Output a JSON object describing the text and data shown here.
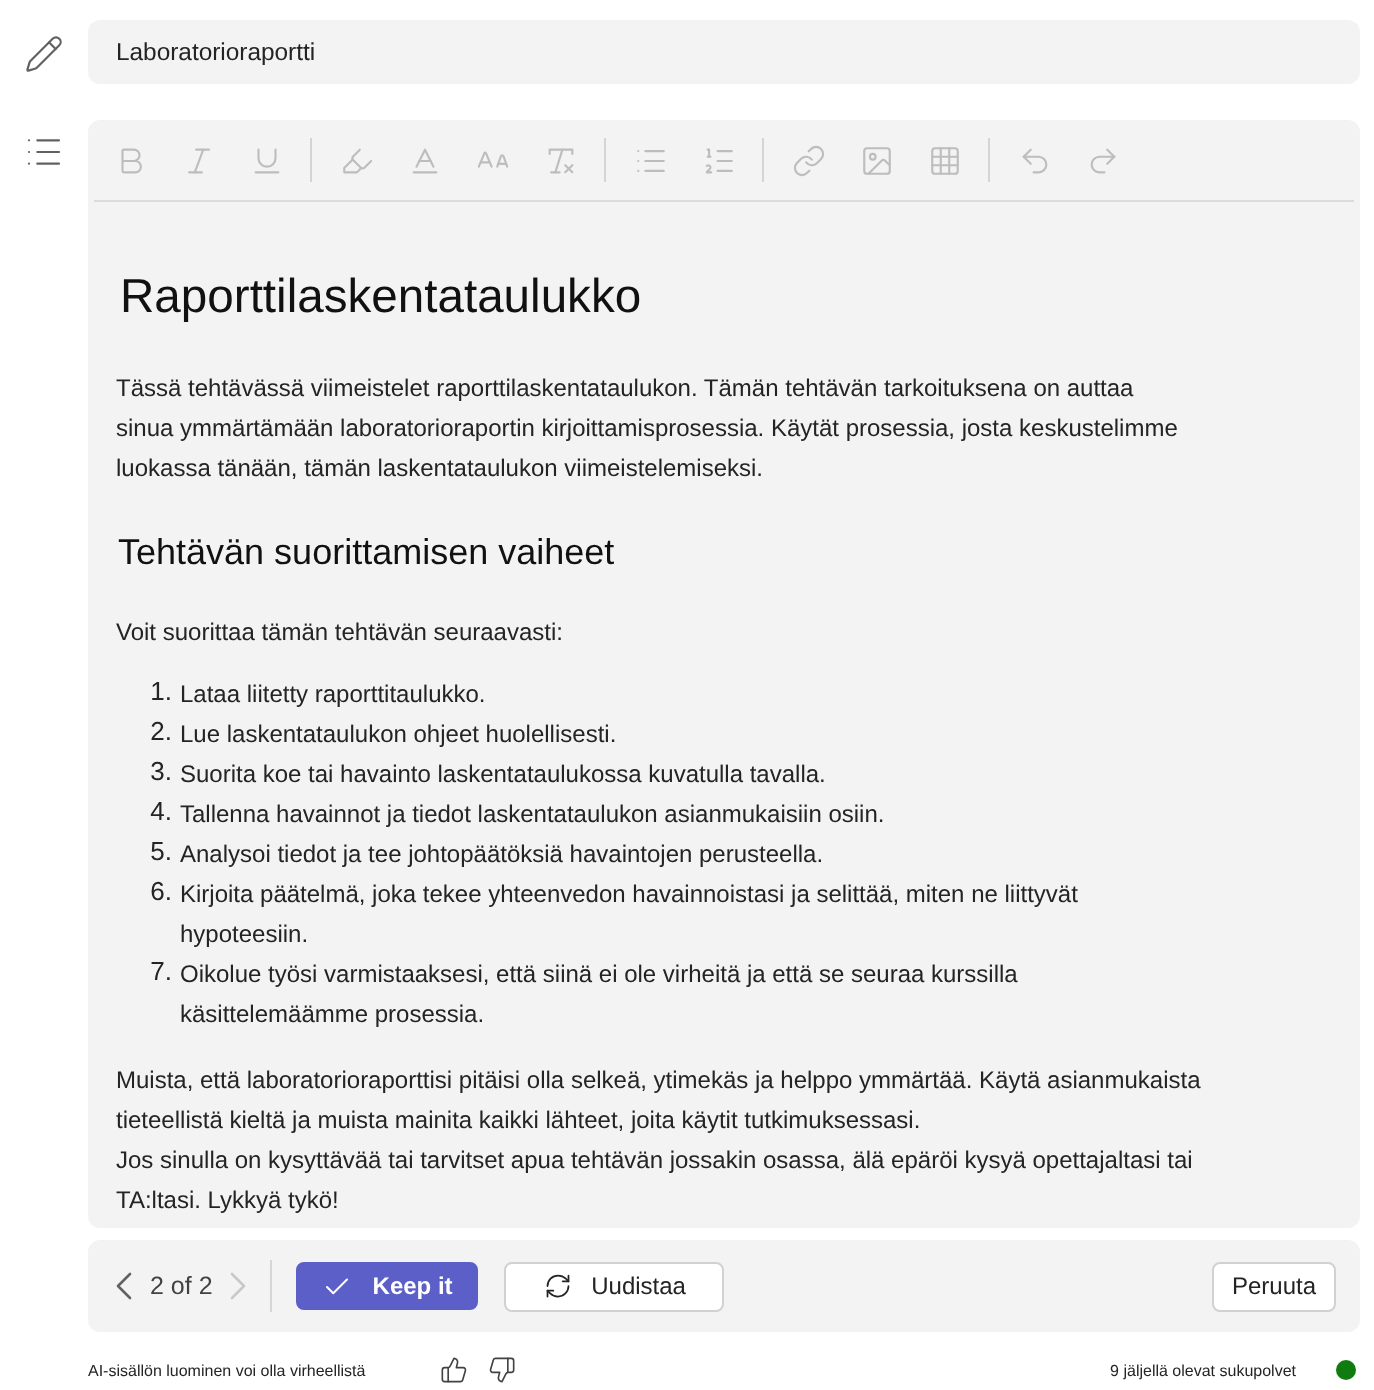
{
  "title_field": {
    "value": "Laboratorioraportti"
  },
  "toolbar": {
    "groups": [
      {
        "tools": [
          {
            "kind": "bold",
            "disabled": true
          },
          {
            "kind": "italic",
            "disabled": true
          },
          {
            "kind": "underline",
            "disabled": true
          }
        ]
      },
      {
        "tools": [
          {
            "kind": "highlight",
            "disabled": true
          },
          {
            "kind": "font_color",
            "disabled": true
          },
          {
            "kind": "font_size",
            "disabled": true
          },
          {
            "kind": "clear_format",
            "disabled": true
          }
        ]
      },
      {
        "tools": [
          {
            "kind": "bulleted_list",
            "disabled": true
          },
          {
            "kind": "numbered_list",
            "disabled": true
          }
        ]
      },
      {
        "tools": [
          {
            "kind": "link",
            "disabled": true
          },
          {
            "kind": "image",
            "disabled": true
          },
          {
            "kind": "table",
            "disabled": true
          }
        ]
      },
      {
        "tools": [
          {
            "kind": "undo",
            "disabled": true
          },
          {
            "kind": "redo",
            "disabled": true
          }
        ]
      }
    ]
  },
  "document": {
    "heading": "Raporttilaskentataulukko",
    "intro": "Tässä tehtävässä viimeistelet raporttilaskentataulukon. Tämän tehtävän tarkoituksena on auttaa sinua ymmärtämään laboratorioraportin kirjoittamisprosessia. Käytät prosessia, josta keskustelimme luokassa tänään, tämän laskentataulukon viimeistelemiseksi.",
    "subheading": "Tehtävän suorittamisen vaiheet",
    "lead": "Voit suorittaa tämän tehtävän seuraavasti:",
    "steps": [
      {
        "number": "1.",
        "text": "Lataa liitetty raporttitaulukko."
      },
      {
        "number": "2.",
        "text": "Lue laskentataulukon ohjeet huolellisesti."
      },
      {
        "number": "3.",
        "text": "Suorita koe tai havainto laskentataulukossa kuvatulla tavalla."
      },
      {
        "number": "4.",
        "text": "Tallenna havainnot ja tiedot laskentataulukon asianmukaisiin osiin."
      },
      {
        "number": "5.",
        "text": "Analysoi tiedot ja tee johtopäätöksiä havaintojen perusteella."
      },
      {
        "number": "6.",
        "text": "Kirjoita päätelmä, joka tekee yhteenvedon havainnoistasi ja selittää, miten ne liittyvät hypoteesiin."
      },
      {
        "number": "7.",
        "text": "Oikolue työsi varmistaaksesi, että siinä ei ole virheitä ja että se seuraa kurssilla käsittelemäämme prosessia."
      }
    ],
    "closing": [
      "Muista, että laboratorioraporttisi pitäisi olla selkeä, ytimekäs ja helppo ymmärtää. Käytä asianmukaista tieteellistä kieltä ja muista mainita kaikki lähteet, joita käytit tutkimuksessasi.",
      "Jos sinulla on kysyttävää tai tarvitset apua tehtävän jossakin osassa, älä epäröi kysyä opettajaltasi tai TA:ltasi. Lykkyä tykö!"
    ]
  },
  "pager": {
    "label": "2 of 2",
    "previous": {
      "disabled": false
    },
    "next": {
      "disabled": true
    }
  },
  "actions": [
    {
      "kind": "primary",
      "label": "Keep it"
    },
    {
      "kind": "regenerate",
      "label": "Uudistaa"
    },
    {
      "kind": "cancel",
      "label": "Peruuta"
    }
  ],
  "footer": {
    "disclaimer": "AI-sisällön luominen voi olla virheellistä",
    "remaining": "9 jäljellä olevat sukupolvet"
  }
}
